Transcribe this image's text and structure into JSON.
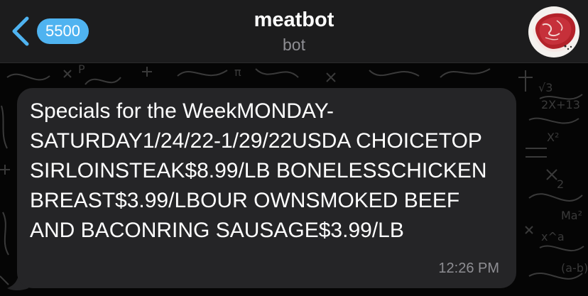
{
  "header": {
    "unread_count": "5500",
    "title": "meatbot",
    "subtitle": "bot"
  },
  "message": {
    "text": "Specials for the WeekMONDAY-SATURDAY1/24/22-1/29/22USDA CHOICETOP SIRLOINSTEAK$8.99/LB BONELESSCHICKEN BREAST$3.99/LBOUR OWNSMOKED BEEF AND BACONRING SAUSAGE$3.99/LB",
    "time": "12:26 PM"
  },
  "icons": {
    "back": "chevron-left-icon",
    "avatar": "steak-avatar"
  },
  "colors": {
    "header_bg": "#1c1c1d",
    "accent": "#4fb3f0",
    "bubble_bg": "#252527",
    "chat_bg": "#050505",
    "muted_text": "#8e8e93"
  }
}
